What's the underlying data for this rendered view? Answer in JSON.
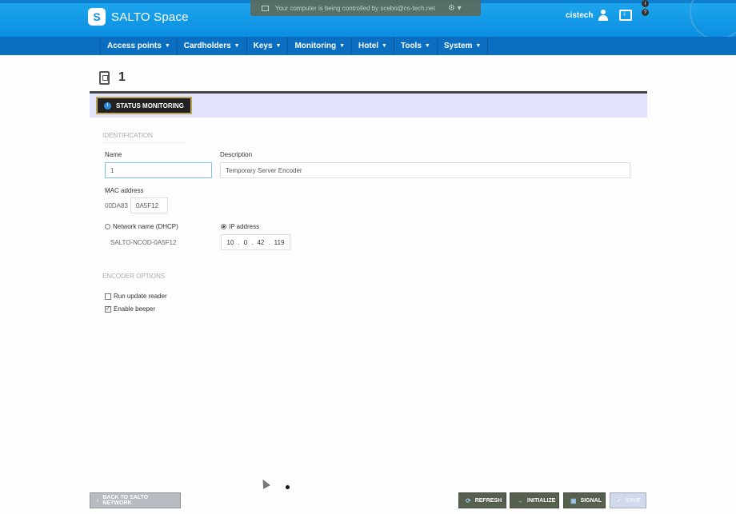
{
  "app": {
    "logo_letter": "S",
    "name": "SALTO Space"
  },
  "remote_banner": {
    "text": "Your computer is being controlled by scebo@cs-tech.net"
  },
  "user": {
    "name": "cistech"
  },
  "nav": [
    {
      "label": "Access points"
    },
    {
      "label": "Cardholders"
    },
    {
      "label": "Keys"
    },
    {
      "label": "Monitoring"
    },
    {
      "label": "Hotel"
    },
    {
      "label": "Tools"
    },
    {
      "label": "System"
    }
  ],
  "page": {
    "title": "1"
  },
  "tab": {
    "label": "STATUS MONITORING"
  },
  "identification": {
    "section_label": "IDENTIFICATION",
    "name_label": "Name",
    "name_value": "1",
    "description_label": "Description",
    "description_value": "Temporary Server Encoder",
    "mac_label": "MAC address",
    "mac_prefix": "00DA83",
    "mac_value": "0A5F12",
    "dhcp_label": "Network name (DHCP)",
    "dhcp_value": "SALTO-NCOD-0A5F12",
    "ip_label": "IP address",
    "ip": [
      "10",
      "0",
      "42",
      "119"
    ]
  },
  "encoder_options": {
    "section_label": "ENCODER OPTIONS",
    "run_update_reader": "Run update reader",
    "run_update_reader_checked": false,
    "enable_beeper": "Enable beeper",
    "enable_beeper_checked": true
  },
  "buttons": {
    "back": "BACK TO SALTO NETWORK",
    "refresh": "REFRESH",
    "initialize": "INITIALIZE",
    "signal": "SIGNAL",
    "save": "SAVE"
  },
  "colors": {
    "header": "#0a8fe0",
    "nav": "#0a6fc0",
    "tab_strip": "#e2e2fa",
    "action_button": "#55604e"
  }
}
